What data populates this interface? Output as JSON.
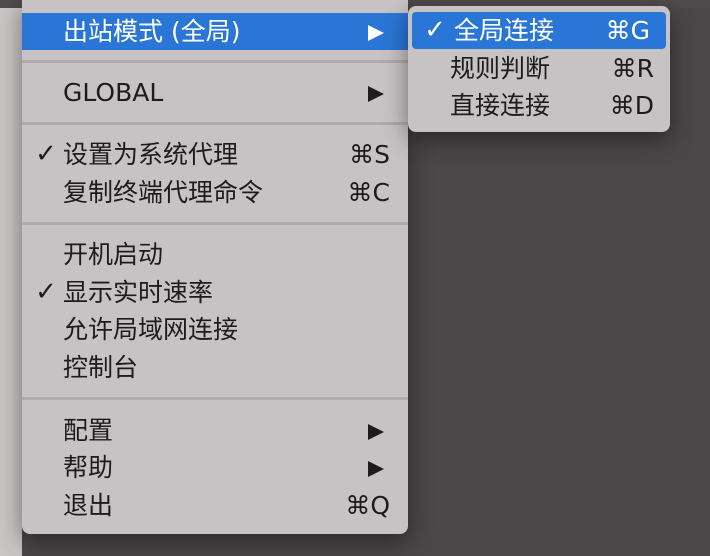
{
  "menu": {
    "outbound_mode": {
      "label": "出站模式 (全局)"
    },
    "global": {
      "label": "GLOBAL"
    },
    "set_system_proxy": {
      "check": "✓",
      "label": "设置为系统代理",
      "shortcut": "⌘S"
    },
    "copy_terminal_cmd": {
      "label": "复制终端代理命令",
      "shortcut": "⌘C"
    },
    "start_at_login": {
      "label": "开机启动"
    },
    "show_speed": {
      "check": "✓",
      "label": "显示实时速率"
    },
    "allow_lan": {
      "label": "允许局域网连接"
    },
    "console": {
      "label": "控制台"
    },
    "config": {
      "label": "配置"
    },
    "help": {
      "label": "帮助"
    },
    "quit": {
      "label": "退出",
      "shortcut": "⌘Q"
    }
  },
  "submenu": {
    "global_connect": {
      "check": "✓",
      "label": "全局连接",
      "shortcut": "⌘G"
    },
    "rule_mode": {
      "label": "规则判断",
      "shortcut": "⌘R"
    },
    "direct_connect": {
      "label": "直接连接",
      "shortcut": "⌘D"
    }
  },
  "colors": {
    "highlight": "#2a76d6",
    "menu_bg": "#c7c3c4",
    "desktop_bg": "#4a4748"
  }
}
